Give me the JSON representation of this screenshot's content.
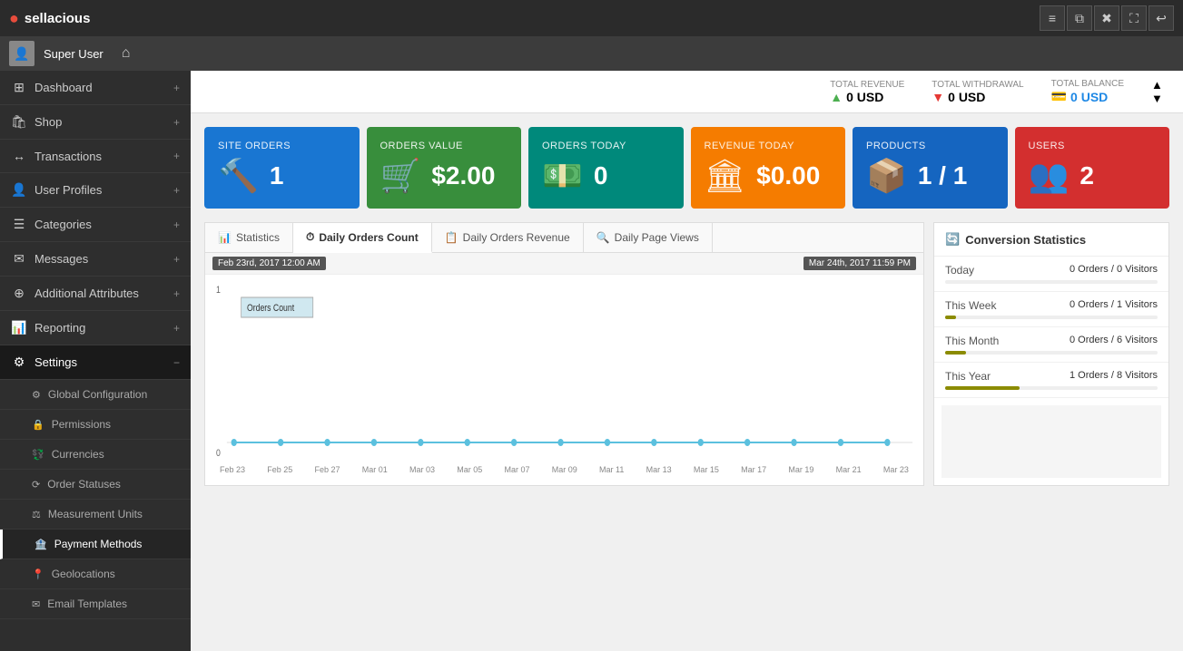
{
  "topbar": {
    "logo_text": "sellacious",
    "icons": [
      "≡",
      "⧉",
      "✖",
      "⛶",
      "↩"
    ]
  },
  "userbar": {
    "username": "Super User",
    "home_icon": "⌂"
  },
  "sidebar": {
    "items": [
      {
        "id": "dashboard",
        "icon": "⊞",
        "label": "Dashboard",
        "expandable": true
      },
      {
        "id": "shop",
        "icon": "🛍",
        "label": "Shop",
        "expandable": true
      },
      {
        "id": "transactions",
        "icon": "↔",
        "label": "Transactions",
        "expandable": true
      },
      {
        "id": "user-profiles",
        "icon": "👤",
        "label": "User Profiles",
        "expandable": true
      },
      {
        "id": "categories",
        "icon": "☰",
        "label": "Categories",
        "expandable": true
      },
      {
        "id": "messages",
        "icon": "✉",
        "label": "Messages",
        "expandable": true
      },
      {
        "id": "additional-attributes",
        "icon": "⊕",
        "label": "Additional Attributes",
        "expandable": true
      },
      {
        "id": "reporting",
        "icon": "📊",
        "label": "Reporting",
        "expandable": true
      },
      {
        "id": "settings",
        "icon": "⚙",
        "label": "Settings",
        "expandable": true,
        "active": true,
        "expanded": true
      }
    ],
    "subitems": [
      {
        "id": "global-config",
        "icon": "⚙",
        "label": "Global Configuration"
      },
      {
        "id": "permissions",
        "icon": "🔒",
        "label": "Permissions"
      },
      {
        "id": "currencies",
        "icon": "💱",
        "label": "Currencies"
      },
      {
        "id": "order-statuses",
        "icon": "⟳",
        "label": "Order Statuses"
      },
      {
        "id": "measurement-units",
        "icon": "⚖",
        "label": "Measurement Units"
      },
      {
        "id": "payment-methods",
        "icon": "🏦",
        "label": "Payment Methods",
        "active": true
      },
      {
        "id": "geolocations",
        "icon": "📍",
        "label": "Geolocations"
      },
      {
        "id": "email-templates",
        "icon": "✉",
        "label": "Email Templates"
      }
    ]
  },
  "stats_header": {
    "total_revenue_label": "TOTAL REVENUE",
    "total_revenue_value": "0 USD",
    "total_withdrawal_label": "TOTAL WITHDRAWAL",
    "total_withdrawal_value": "0 USD",
    "total_balance_label": "TOTAL BALANCE",
    "total_balance_value": "0 USD"
  },
  "tiles": [
    {
      "id": "site-orders",
      "color": "tile-blue",
      "label": "SITE ORDERS",
      "icon": "🔨",
      "value": "1"
    },
    {
      "id": "orders-value",
      "color": "tile-green",
      "label": "ORDERS VALUE",
      "icon": "🛒",
      "value": "$2.00"
    },
    {
      "id": "orders-today",
      "color": "tile-cyan",
      "label": "ORDERS TODAY",
      "icon": "💵",
      "value": "0"
    },
    {
      "id": "revenue-today",
      "color": "tile-orange",
      "label": "REVENUE TODAY",
      "icon": "🏛",
      "value": "$0.00"
    },
    {
      "id": "products",
      "color": "tile-navy",
      "label": "PRODUCTS",
      "icon": "📦",
      "value": "1 / 1"
    },
    {
      "id": "users",
      "color": "tile-red",
      "label": "USERS",
      "icon": "👥",
      "value": "2"
    }
  ],
  "chart": {
    "tabs": [
      {
        "id": "statistics",
        "label": "Statistics",
        "icon": "📊"
      },
      {
        "id": "daily-orders-count",
        "label": "Daily Orders Count",
        "icon": "⏱",
        "active": true
      },
      {
        "id": "daily-orders-revenue",
        "label": "Daily Orders Revenue",
        "icon": "📋"
      },
      {
        "id": "daily-page-views",
        "label": "Daily Page Views",
        "icon": "🔍"
      }
    ],
    "date_start": "Feb 23rd, 2017 12:00 AM",
    "date_end": "Mar 24th, 2017 11:59 PM",
    "y_max": "1",
    "y_min": "0",
    "legend": "Orders Count",
    "xaxis_labels": [
      "Feb 23",
      "Feb 25",
      "Feb 27",
      "Mar 01",
      "Mar 03",
      "Mar 05",
      "Mar 07",
      "Mar 09",
      "Mar 11",
      "Mar 13",
      "Mar 15",
      "Mar 17",
      "Mar 19",
      "Mar 21",
      "Mar 23"
    ]
  },
  "conversion": {
    "title": "Conversion Statistics",
    "rows": [
      {
        "label": "Today",
        "value": "0 Orders / 0 Visitors",
        "bar_pct": 0
      },
      {
        "label": "This Week",
        "value": "0 Orders / 1 Visitors",
        "bar_pct": 5
      },
      {
        "label": "This Month",
        "value": "0 Orders / 6 Visitors",
        "bar_pct": 10
      },
      {
        "label": "This Year",
        "value": "1 Orders / 8 Visitors",
        "bar_pct": 35
      }
    ]
  }
}
